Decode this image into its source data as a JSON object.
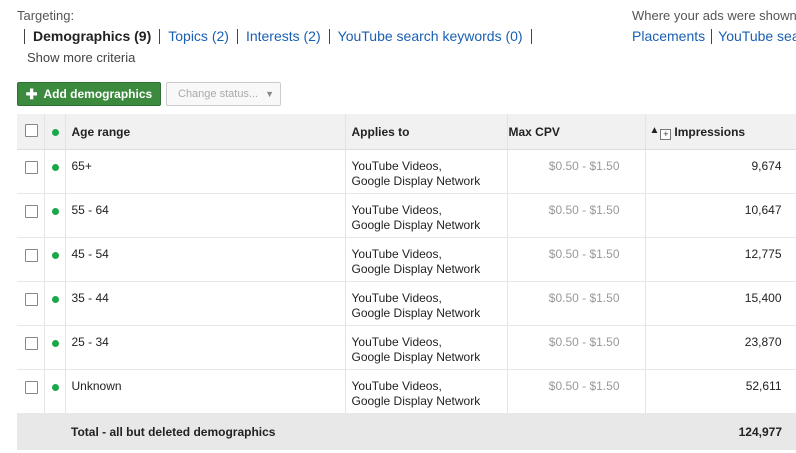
{
  "targeting": {
    "label": "Targeting:",
    "tabs": [
      {
        "label": "Demographics (9)",
        "active": true
      },
      {
        "label": "Topics (2)",
        "active": false
      },
      {
        "label": "Interests (2)",
        "active": false
      },
      {
        "label": "YouTube search keywords (0)",
        "active": false
      }
    ],
    "show_more": "Show more criteria"
  },
  "placement_section": {
    "label": "Where your ads were shown",
    "tabs": [
      "Placements",
      "YouTube sea"
    ]
  },
  "toolbar": {
    "add_label": "Add demographics",
    "status_label": "Change status..."
  },
  "table": {
    "headers": {
      "age": "Age range",
      "applies": "Applies to",
      "cpv": "Max CPV",
      "impressions": "Impressions"
    },
    "rows": [
      {
        "age": "65+",
        "applies_1": "YouTube Videos,",
        "applies_2": "Google Display Network",
        "cpv": "$0.50 - $1.50",
        "impressions": "9,674"
      },
      {
        "age": "55 - 64",
        "applies_1": "YouTube Videos,",
        "applies_2": "Google Display Network",
        "cpv": "$0.50 - $1.50",
        "impressions": "10,647"
      },
      {
        "age": "45 - 54",
        "applies_1": "YouTube Videos,",
        "applies_2": "Google Display Network",
        "cpv": "$0.50 - $1.50",
        "impressions": "12,775"
      },
      {
        "age": "35 - 44",
        "applies_1": "YouTube Videos,",
        "applies_2": "Google Display Network",
        "cpv": "$0.50 - $1.50",
        "impressions": "15,400"
      },
      {
        "age": "25 - 34",
        "applies_1": "YouTube Videos,",
        "applies_2": "Google Display Network",
        "cpv": "$0.50 - $1.50",
        "impressions": "23,870"
      },
      {
        "age": "Unknown",
        "applies_1": "YouTube Videos,",
        "applies_2": "Google Display Network",
        "cpv": "$0.50 - $1.50",
        "impressions": "52,611"
      }
    ],
    "total_label": "Total - all but deleted demographics",
    "total_impressions": "124,977"
  },
  "colors": {
    "status_enabled": "#1aa84a",
    "button_green": "#3c8a3e",
    "link_blue": "#1a5fb4"
  }
}
